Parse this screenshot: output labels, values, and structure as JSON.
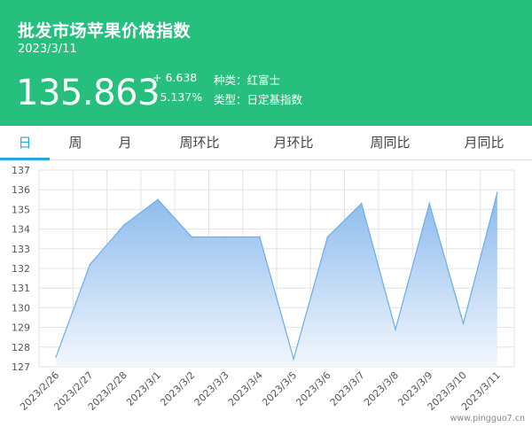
{
  "header": {
    "title": "批发市场苹果价格指数",
    "date": "2023/3/11",
    "price": "135.863",
    "change": "+ 6.638",
    "change_pct": "↑5.137%",
    "variety": "种类：红富士",
    "index_type": "类型：日定基指数"
  },
  "tabs": [
    {
      "label": "日",
      "active": true
    },
    {
      "label": "周",
      "active": false
    },
    {
      "label": "月",
      "active": false
    },
    {
      "label": "周环比",
      "active": false
    },
    {
      "label": "月环比",
      "active": false
    },
    {
      "label": "周同比",
      "active": false
    },
    {
      "label": "月同比",
      "active": false
    }
  ],
  "colors": {
    "header_bg": "#26bf7e",
    "tab_active": "#26a6d9",
    "area_line": "#6aaee9",
    "area_fill_top": "#8ab9ec",
    "area_fill_bottom": "#f3f7fd"
  },
  "chart_data": {
    "type": "area",
    "categories": [
      "2023/2/26",
      "2023/2/27",
      "2023/2/28",
      "2023/3/1",
      "2023/3/2",
      "2023/3/3",
      "2023/3/4",
      "2023/3/5",
      "2023/3/6",
      "2023/3/7",
      "2023/3/8",
      "2023/3/9",
      "2023/3/10",
      "2023/3/11"
    ],
    "values": [
      127.5,
      132.2,
      134.2,
      135.5,
      133.6,
      133.6,
      133.6,
      127.4,
      133.6,
      135.3,
      128.9,
      135.3,
      129.2,
      135.863
    ],
    "ylim": [
      127,
      137
    ],
    "yticks": [
      127,
      128,
      129,
      130,
      131,
      132,
      133,
      134,
      135,
      136,
      137
    ],
    "grid": true,
    "legend": "none"
  },
  "watermark": "www.pingguo7.cn"
}
